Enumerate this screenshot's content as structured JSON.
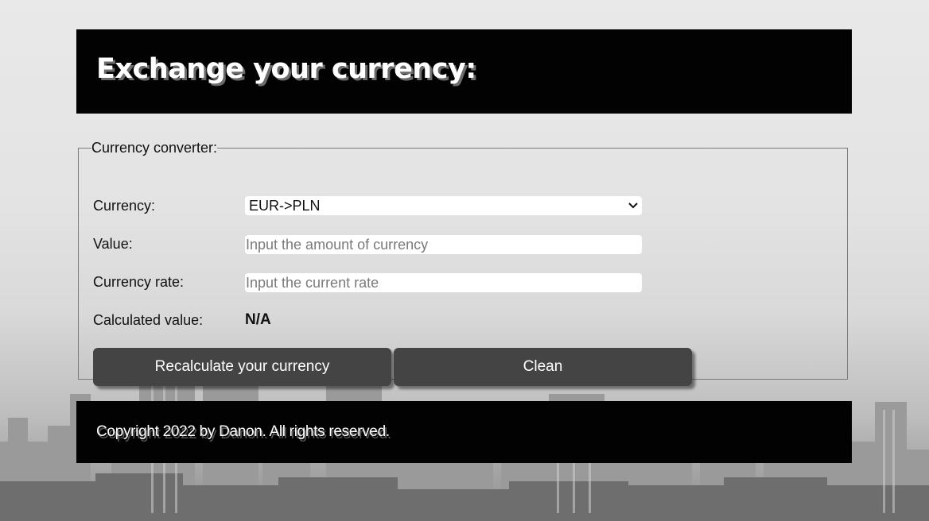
{
  "header": {
    "title": "Exchange your currency:"
  },
  "converter": {
    "legend": "Currency converter:",
    "currency": {
      "label": "Currency:",
      "selected": "EUR->PLN",
      "icon": "chevron-down-icon"
    },
    "value": {
      "label": "Value:",
      "value": "",
      "placeholder": "Input the amount of currency"
    },
    "rate": {
      "label": "Currency rate:",
      "value": "",
      "placeholder": "Input the current rate"
    },
    "calculated": {
      "label": "Calculated value:",
      "value": "N/A"
    },
    "buttons": {
      "recalculate_label": "Recalculate your currency",
      "clean_label": "Clean"
    }
  },
  "footer": {
    "copyright": "Copyright 2022 by Danon. All rights reserved."
  },
  "colors": {
    "header_bg": "#020202",
    "button_bg": "#444444",
    "page_bg": "#e6e6e6"
  }
}
